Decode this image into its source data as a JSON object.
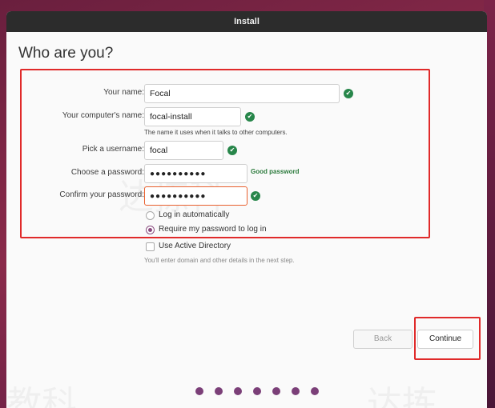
{
  "window": {
    "title": "Install"
  },
  "page": {
    "title": "Who are you?"
  },
  "form": {
    "name": {
      "label": "Your name:",
      "value": "Focal"
    },
    "computer": {
      "label": "Your computer's name:",
      "value": "focal-install",
      "hint": "The name it uses when it talks to other computers."
    },
    "username": {
      "label": "Pick a username:",
      "value": "focal"
    },
    "password": {
      "label": "Choose a password:",
      "value": "●●●●●●●●●●",
      "strength": "Good password"
    },
    "confirm": {
      "label": "Confirm your password:",
      "value": "●●●●●●●●●●"
    },
    "login_options": [
      {
        "label": "Log in automatically",
        "selected": false
      },
      {
        "label": "Require my password to log in",
        "selected": true
      }
    ],
    "active_directory": {
      "label": "Use Active Directory",
      "checked": false,
      "hint": "You'll enter domain and other details in the next step."
    }
  },
  "buttons": {
    "back": "Back",
    "continue": "Continue"
  },
  "progress": {
    "total_steps": 7
  },
  "colors": {
    "accent": "#7b3f78",
    "check": "#27864a",
    "highlight": "#e02a2a",
    "focus": "#e9612f"
  },
  "icons": {
    "field_valid": "check-circle-icon"
  }
}
